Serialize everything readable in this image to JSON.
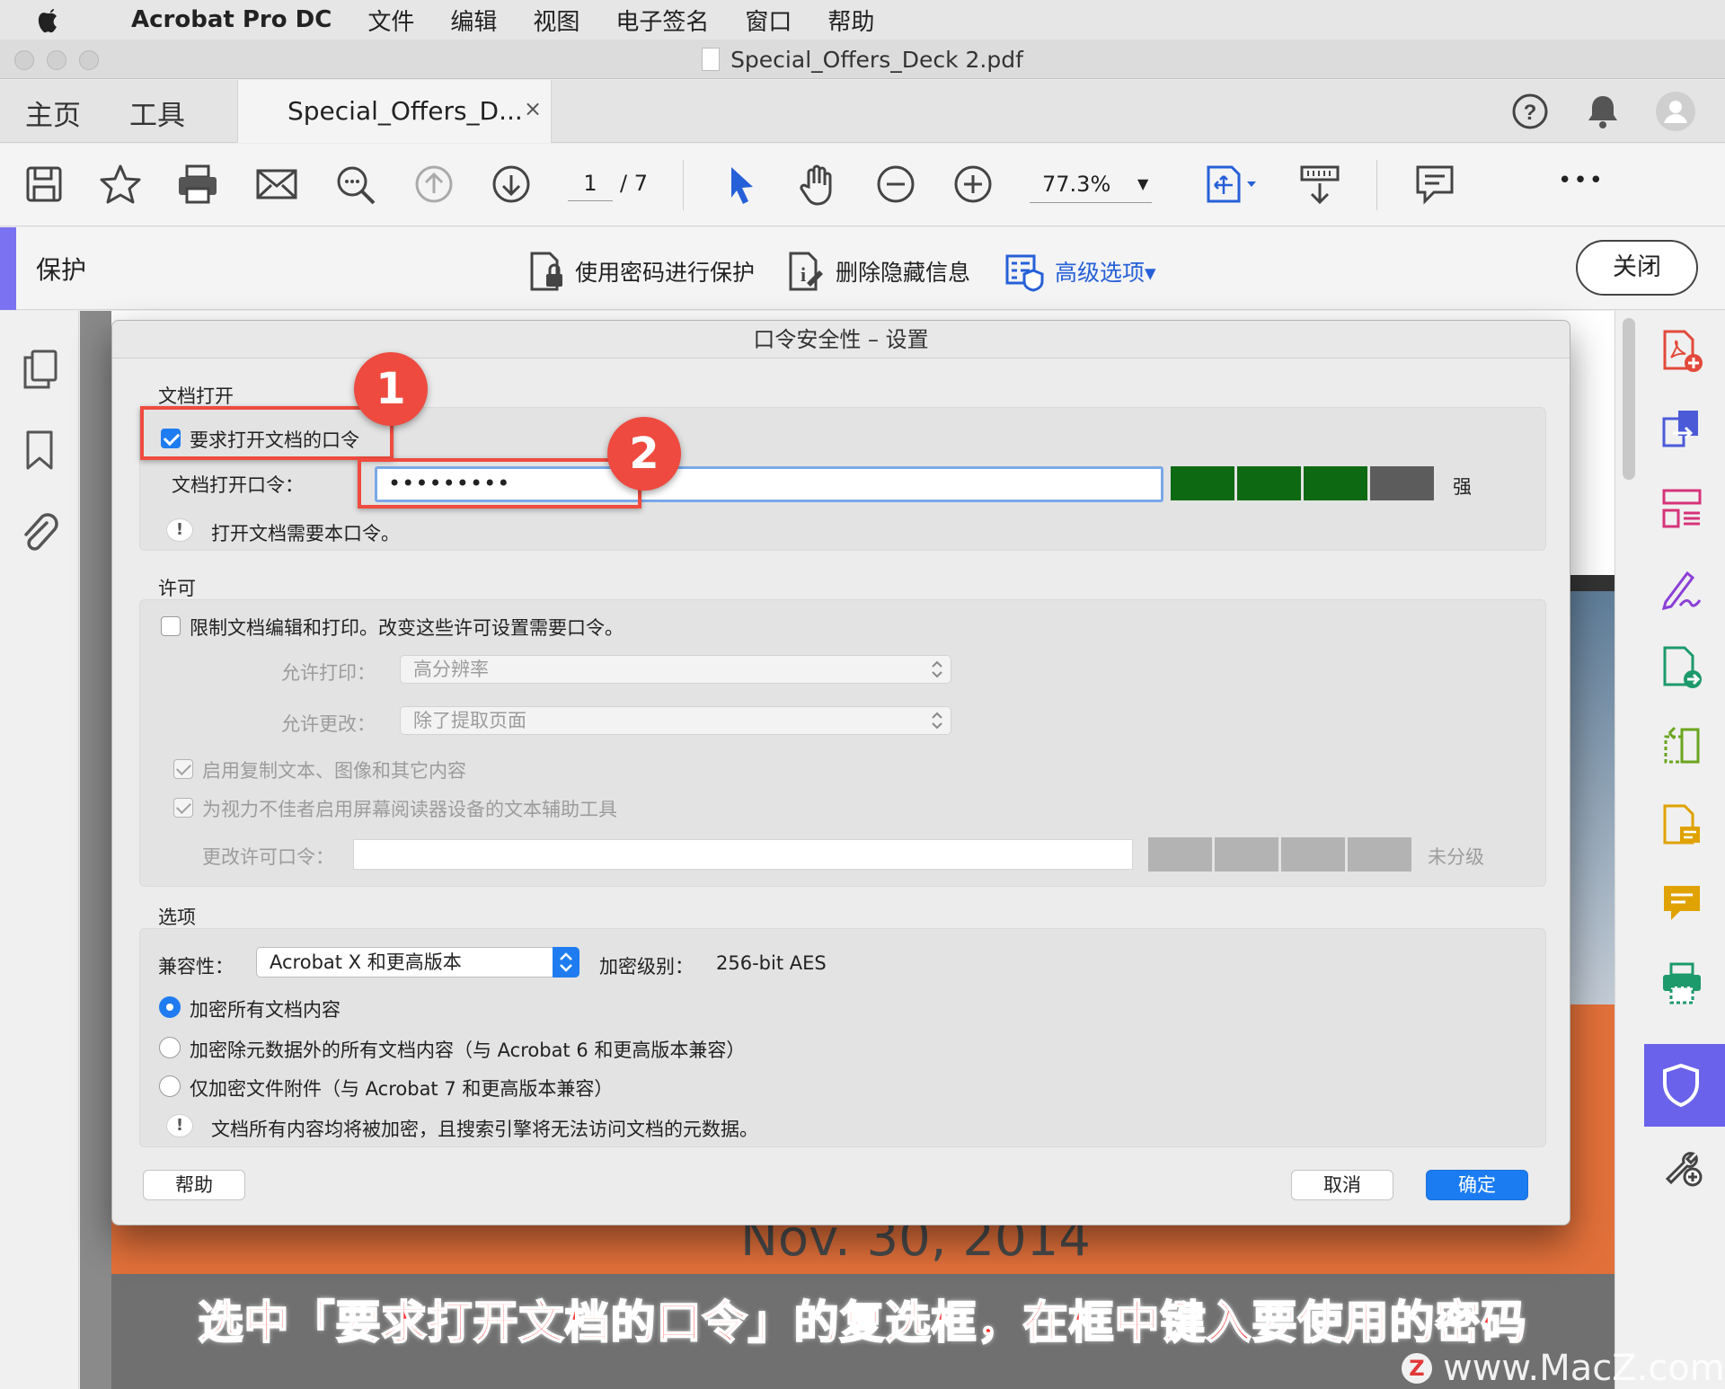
{
  "menubar": {
    "app_name": "Acrobat Pro DC",
    "items": [
      "文件",
      "编辑",
      "视图",
      "电子签名",
      "窗口",
      "帮助"
    ]
  },
  "window": {
    "title": "Special_Offers_Deck 2.pdf"
  },
  "tabs": {
    "home": "主页",
    "tools": "工具",
    "doc_tab": "Special_Offers_D...",
    "doc_tab_close": "×"
  },
  "toolbar": {
    "page_current": "1",
    "page_total": "/ 7",
    "zoom": "77.3%",
    "more": "•••"
  },
  "protect_bar": {
    "title": "保护",
    "password_protect": "使用密码进行保护",
    "remove_hidden": "删除隐藏信息",
    "advanced": "高级选项▾",
    "close": "关闭"
  },
  "document": {
    "date_fragment": "Nov. 30, 2014"
  },
  "dialog": {
    "title": "口令安全性 – 设置",
    "doc_open": {
      "section": "文档打开",
      "require_password_label": "要求打开文档的口令",
      "require_password_checked": true,
      "password_label": "文档打开口令：",
      "password_value": "•••••••••",
      "strength_label": "强",
      "strength_level": 3,
      "strength_max": 4,
      "note": "打开文档需要本口令。"
    },
    "permissions": {
      "section": "许可",
      "restrict_label": "限制文档编辑和打印。改变这些许可设置需要口令。",
      "restrict_checked": false,
      "allow_print_label": "允许打印：",
      "allow_print_value": "高分辨率",
      "allow_changes_label": "允许更改：",
      "allow_changes_value": "除了提取页面",
      "enable_copy_label": "启用复制文本、图像和其它内容",
      "enable_screenreader_label": "为视力不佳者启用屏幕阅读器设备的文本辅助工具",
      "change_password_label": "更改许可口令：",
      "change_password_value": "",
      "strength_label": "未分级"
    },
    "options": {
      "section": "选项",
      "compat_label": "兼容性：",
      "compat_value": "Acrobat X 和更高版本",
      "encryption_label": "加密级别：",
      "encryption_value": "256-bit AES",
      "radio_all": "加密所有文档内容",
      "radio_except_metadata": "加密除元数据外的所有文档内容（与 Acrobat 6 和更高版本兼容）",
      "radio_attachments": "仅加密文件附件（与 Acrobat 7 和更高版本兼容）",
      "selected": "all",
      "note": "文档所有内容均将被加密，且搜索引擎将无法访问文档的元数据。"
    },
    "buttons": {
      "help": "帮助",
      "cancel": "取消",
      "ok": "确定"
    }
  },
  "annotations": {
    "marker1": "1",
    "marker2": "2",
    "caption": "选中「要求打开文档的口令」的复选框，在框中键入要使用的密码",
    "watermark": "www.MacZ.com",
    "watermark_logo": "Z"
  },
  "colors": {
    "accent_purple": "#6a62ea",
    "strength_green": "#0e6a12",
    "strength_grey": "#5c5c5c",
    "annotation_red": "#ef4b3f",
    "primary_blue": "#1b7cf2"
  },
  "icons": {
    "toolbar": [
      "save-icon",
      "star-icon",
      "print-icon",
      "mail-icon",
      "search-zoom-icon",
      "page-up-icon",
      "page-down-icon",
      "select-arrow-icon",
      "hand-icon",
      "zoom-out-icon",
      "zoom-in-icon",
      "fit-page-icon",
      "scroll-mode-icon",
      "comment-icon",
      "more-icon"
    ],
    "left_panel": [
      "pages-icon",
      "bookmark-icon",
      "attachment-icon"
    ],
    "right_panel": [
      "create-pdf-icon",
      "export-pdf-icon",
      "organize-pages-icon",
      "fill-sign-icon",
      "send-pdf-icon",
      "compare-icon",
      "edit-pdf-icon",
      "comment-tool-icon",
      "print-production-icon",
      "protect-shield-icon",
      "more-tools-icon"
    ]
  }
}
